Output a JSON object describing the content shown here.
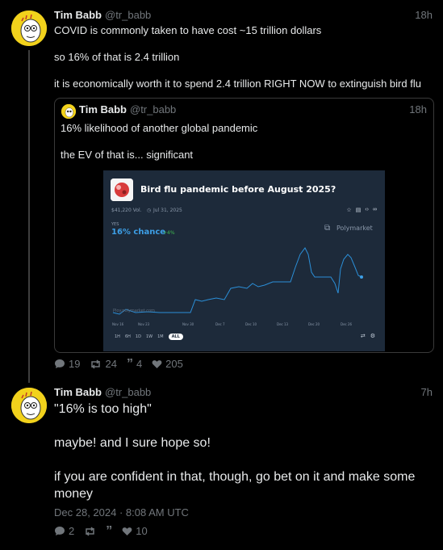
{
  "post1": {
    "author": "Tim Babb",
    "handle": "@tr_babb",
    "time": "18h",
    "paragraphs": [
      "COVID is commonly taken to have cost ~15 trillion dollars",
      "so 16% of that is 2.4 trillion",
      "it is economically worth it to spend 2.4 trillion RIGHT NOW to extinguish bird flu"
    ],
    "stats": {
      "replies": "19",
      "reposts": "24",
      "quotes": "4",
      "likes": "205"
    }
  },
  "quote": {
    "author": "Tim Babb",
    "handle": "@tr_babb",
    "time": "18h",
    "paragraphs": [
      "16% likelihood of another global pandemic",
      "the EV of that is... significant"
    ],
    "embed": {
      "title": "Bird flu pandemic before August 2025?",
      "volume": "$41,220 Vol.",
      "end_date": "Jul 31, 2025",
      "outcome": "YES",
      "chance": "16% chance",
      "change": "+4%",
      "brand": "Polymarket",
      "watermark": "Ploy.polymarket.com",
      "x_ticks": [
        "Nov 16",
        "Nov 23",
        "Nov 30",
        "Dec 7",
        "Dec 10",
        "Dec 13",
        "Dec 20",
        "Dec 26"
      ],
      "ranges": [
        "1H",
        "6H",
        "1D",
        "1W",
        "1M",
        "ALL"
      ],
      "active_range": "ALL",
      "colors": {
        "line": "#2b8fd8",
        "bg": "#1d2a3a",
        "chance": "#3d9fe6",
        "change": "#3fb950"
      }
    }
  },
  "post2": {
    "author": "Tim Babb",
    "handle": "@tr_babb",
    "time": "7h",
    "paragraphs": [
      "\"16% is too high\"",
      "maybe! and I sure hope so!",
      "if you are confident in that, though, go bet on it and make some money"
    ],
    "timestamp": "Dec 28, 2024 · 8:08 AM UTC",
    "stats": {
      "replies": "2",
      "likes": "10"
    }
  }
}
